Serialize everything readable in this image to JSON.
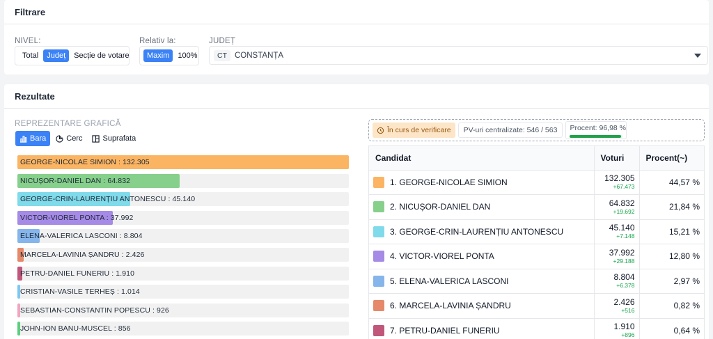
{
  "filter": {
    "title": "Filtrare",
    "nivel": {
      "label": "NIVEL:",
      "options": [
        "Total",
        "Județ",
        "Secție de votare"
      ],
      "active": 1
    },
    "relativ": {
      "label": "Relativ la:",
      "options": [
        "Maxim",
        "100%"
      ],
      "active": 0
    },
    "judet": {
      "label": "JUDEȚ",
      "code": "CT",
      "name": "CONSTANȚA"
    }
  },
  "results": {
    "title": "Rezultate",
    "representation_label": "REPREZENTARE GRAFICĂ",
    "chart_tabs": [
      {
        "label": "Bara",
        "icon": "bar-chart-icon"
      },
      {
        "label": "Cerc",
        "icon": "pie-chart-icon"
      },
      {
        "label": "Suprafata",
        "icon": "treemap-icon"
      }
    ],
    "active_tab": 0
  },
  "status": {
    "verify": "În curs de verificare",
    "pv": "PV-uri centralizate: 546 / 563",
    "procent_label": "Procent: 96,98 %",
    "procent_value": 96.98
  },
  "table": {
    "headers": {
      "candidate": "Candidat",
      "votes": "Voturi",
      "percent": "Procent(~)"
    },
    "rows": [
      {
        "name": "1. GEORGE-NICOLAE SIMION",
        "votes": "132.305",
        "delta": "+67.473",
        "percent": "44,57 %",
        "color": "#fbb462"
      },
      {
        "name": "2. NICUȘOR-DANIEL DAN",
        "votes": "64.832",
        "delta": "+19.692",
        "percent": "21,84 %",
        "color": "#86d08c"
      },
      {
        "name": "3. GEORGE-CRIN-LAURENȚIU ANTONESCU",
        "votes": "45.140",
        "delta": "+7.148",
        "percent": "15,21 %",
        "color": "#7fdaea"
      },
      {
        "name": "4. VICTOR-VIOREL PONTA",
        "votes": "37.992",
        "delta": "+29.188",
        "percent": "12,80 %",
        "color": "#a58ae6"
      },
      {
        "name": "5. ELENA-VALERICA LASCONI",
        "votes": "8.804",
        "delta": "+6.378",
        "percent": "2,97 %",
        "color": "#85b5ea"
      },
      {
        "name": "6. MARCELA-LAVINIA ȘANDRU",
        "votes": "2.426",
        "delta": "+516",
        "percent": "0,82 %",
        "color": "#e5896a"
      },
      {
        "name": "7. PETRU-DANIEL FUNERIU",
        "votes": "1.910",
        "delta": "+896",
        "percent": "0,64 %",
        "color": "#c0567a"
      }
    ]
  },
  "chart_data": {
    "type": "bar",
    "orientation": "horizontal",
    "categories": [
      "GEORGE-NICOLAE SIMION",
      "NICUȘOR-DANIEL DAN",
      "GEORGE-CRIN-LAURENȚIU ANTONESCU",
      "VICTOR-VIOREL PONTA",
      "ELENA-VALERICA LASCONI",
      "MARCELA-LAVINIA ȘANDRU",
      "PETRU-DANIEL FUNERIU",
      "CRISTIAN-VASILE TERHEȘ",
      "SEBASTIAN-CONSTANTIN POPESCU",
      "JOHN-ION BANU-MUSCEL"
    ],
    "values": [
      132305,
      64832,
      45140,
      37992,
      8804,
      2426,
      1910,
      1014,
      926,
      856
    ],
    "labels": [
      "GEORGE-NICOLAE SIMION : 132.305",
      "NICUȘOR-DANIEL DAN : 64.832",
      "GEORGE-CRIN-LAURENȚIU ANTONESCU : 45.140",
      "VICTOR-VIOREL PONTA : 37.992",
      "ELENA-VALERICA LASCONI : 8.804",
      "MARCELA-LAVINIA ȘANDRU : 2.426",
      "PETRU-DANIEL FUNERIU : 1.910",
      "CRISTIAN-VASILE TERHEȘ : 1.014",
      "SEBASTIAN-CONSTANTIN POPESCU : 926",
      "JOHN-ION BANU-MUSCEL : 856"
    ],
    "colors": [
      "#fbb462",
      "#86d08c",
      "#7fdaea",
      "#a58ae6",
      "#85b5ea",
      "#e5896a",
      "#c0567a",
      "#7cc8f0",
      "#f0a5c0",
      "#5ccf7e"
    ],
    "xlim": [
      0,
      132305
    ],
    "title": "",
    "xlabel": "",
    "ylabel": ""
  }
}
